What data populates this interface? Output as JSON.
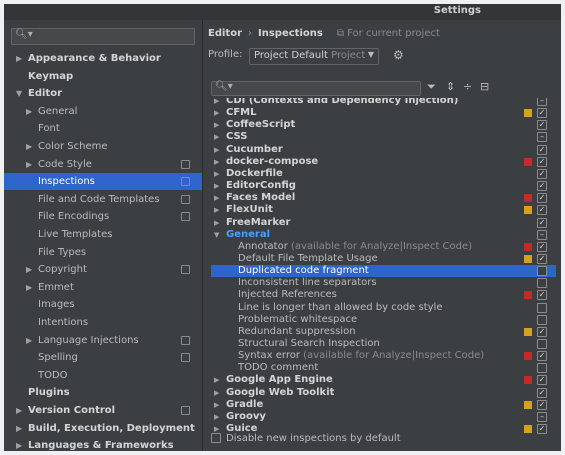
{
  "window": {
    "title": "Settings"
  },
  "sidebar": {
    "search_placeholder": "",
    "items": [
      {
        "label": "Appearance & Behavior",
        "bold": true,
        "level": 0,
        "arrow": "right",
        "badge": false,
        "selected": false
      },
      {
        "label": "Keymap",
        "bold": true,
        "level": 0,
        "arrow": "",
        "badge": false,
        "selected": false
      },
      {
        "label": "Editor",
        "bold": true,
        "level": 0,
        "arrow": "down",
        "badge": false,
        "selected": false
      },
      {
        "label": "General",
        "bold": false,
        "level": 1,
        "arrow": "right",
        "badge": false,
        "selected": false
      },
      {
        "label": "Font",
        "bold": false,
        "level": 1,
        "arrow": "",
        "badge": false,
        "selected": false
      },
      {
        "label": "Color Scheme",
        "bold": false,
        "level": 1,
        "arrow": "right",
        "badge": false,
        "selected": false
      },
      {
        "label": "Code Style",
        "bold": false,
        "level": 1,
        "arrow": "right",
        "badge": true,
        "selected": false
      },
      {
        "label": "Inspections",
        "bold": false,
        "level": 1,
        "arrow": "",
        "badge": true,
        "selected": true
      },
      {
        "label": "File and Code Templates",
        "bold": false,
        "level": 1,
        "arrow": "",
        "badge": true,
        "selected": false
      },
      {
        "label": "File Encodings",
        "bold": false,
        "level": 1,
        "arrow": "",
        "badge": true,
        "selected": false
      },
      {
        "label": "Live Templates",
        "bold": false,
        "level": 1,
        "arrow": "",
        "badge": false,
        "selected": false
      },
      {
        "label": "File Types",
        "bold": false,
        "level": 1,
        "arrow": "",
        "badge": false,
        "selected": false
      },
      {
        "label": "Copyright",
        "bold": false,
        "level": 1,
        "arrow": "right",
        "badge": true,
        "selected": false
      },
      {
        "label": "Emmet",
        "bold": false,
        "level": 1,
        "arrow": "right",
        "badge": false,
        "selected": false
      },
      {
        "label": "Images",
        "bold": false,
        "level": 1,
        "arrow": "",
        "badge": false,
        "selected": false
      },
      {
        "label": "Intentions",
        "bold": false,
        "level": 1,
        "arrow": "",
        "badge": false,
        "selected": false
      },
      {
        "label": "Language Injections",
        "bold": false,
        "level": 1,
        "arrow": "right",
        "badge": true,
        "selected": false
      },
      {
        "label": "Spelling",
        "bold": false,
        "level": 1,
        "arrow": "",
        "badge": true,
        "selected": false
      },
      {
        "label": "TODO",
        "bold": false,
        "level": 1,
        "arrow": "",
        "badge": false,
        "selected": false
      },
      {
        "label": "Plugins",
        "bold": true,
        "level": 0,
        "arrow": "",
        "badge": false,
        "selected": false
      },
      {
        "label": "Version Control",
        "bold": true,
        "level": 0,
        "arrow": "right",
        "badge": true,
        "selected": false
      },
      {
        "label": "Build, Execution, Deployment",
        "bold": true,
        "level": 0,
        "arrow": "right",
        "badge": false,
        "selected": false
      },
      {
        "label": "Languages & Frameworks",
        "bold": true,
        "level": 0,
        "arrow": "right",
        "badge": false,
        "selected": false
      }
    ]
  },
  "header": {
    "crumb_root": "Editor",
    "crumb_sep": "›",
    "crumb_leaf": "Inspections",
    "scope_note": "For current project",
    "profile_label": "Profile:",
    "profile_value": "Project Default",
    "profile_kind": "Project"
  },
  "colors": {
    "error": "#c72929",
    "warning": "#d6a11e",
    "selection": "#2f65ca"
  },
  "inspections": [
    {
      "label": "CDI (Contexts and Dependency Injection)",
      "group": true,
      "expanded": false,
      "sev": "",
      "check": "mixed"
    },
    {
      "label": "CFML",
      "group": true,
      "expanded": false,
      "sev": "warning",
      "check": "checked"
    },
    {
      "label": "CoffeeScript",
      "group": true,
      "expanded": false,
      "sev": "",
      "check": "checked"
    },
    {
      "label": "CSS",
      "group": true,
      "expanded": false,
      "sev": "",
      "check": "mixed"
    },
    {
      "label": "Cucumber",
      "group": true,
      "expanded": false,
      "sev": "",
      "check": "checked"
    },
    {
      "label": "docker-compose",
      "group": true,
      "expanded": false,
      "sev": "error",
      "check": "checked"
    },
    {
      "label": "Dockerfile",
      "group": true,
      "expanded": false,
      "sev": "",
      "check": "checked"
    },
    {
      "label": "EditorConfig",
      "group": true,
      "expanded": false,
      "sev": "",
      "check": "checked"
    },
    {
      "label": "Faces Model",
      "group": true,
      "expanded": false,
      "sev": "error",
      "check": "checked"
    },
    {
      "label": "FlexUnit",
      "group": true,
      "expanded": false,
      "sev": "warning",
      "check": "checked"
    },
    {
      "label": "FreeMarker",
      "group": true,
      "expanded": false,
      "sev": "",
      "check": "checked"
    },
    {
      "label": "General",
      "group": true,
      "expanded": true,
      "sev": "",
      "check": "mixed",
      "accent": true
    },
    {
      "label": "Annotator",
      "note": "(available for Analyze|Inspect Code)",
      "group": false,
      "sev": "error",
      "check": "checked"
    },
    {
      "label": "Default File Template Usage",
      "group": false,
      "sev": "warning",
      "check": "checked"
    },
    {
      "label": "Duplicated code fragment",
      "group": false,
      "sev": "",
      "check": "unchecked",
      "selected": true
    },
    {
      "label": "Inconsistent line separators",
      "group": false,
      "sev": "",
      "check": "unchecked"
    },
    {
      "label": "Injected References",
      "group": false,
      "sev": "error",
      "check": "checked"
    },
    {
      "label": "Line is longer than allowed by code style",
      "group": false,
      "sev": "",
      "check": "unchecked"
    },
    {
      "label": "Problematic whitespace",
      "group": false,
      "sev": "",
      "check": "unchecked"
    },
    {
      "label": "Redundant suppression",
      "group": false,
      "sev": "warning",
      "check": "checked"
    },
    {
      "label": "Structural Search Inspection",
      "group": false,
      "sev": "",
      "check": "unchecked"
    },
    {
      "label": "Syntax error",
      "note": "(available for Analyze|Inspect Code)",
      "group": false,
      "sev": "error",
      "check": "checked"
    },
    {
      "label": "TODO comment",
      "group": false,
      "sev": "",
      "check": "unchecked"
    },
    {
      "label": "Google App Engine",
      "group": true,
      "expanded": false,
      "sev": "error",
      "check": "checked"
    },
    {
      "label": "Google Web Toolkit",
      "group": true,
      "expanded": false,
      "sev": "",
      "check": "checked"
    },
    {
      "label": "Gradle",
      "group": true,
      "expanded": false,
      "sev": "warning",
      "check": "checked"
    },
    {
      "label": "Groovy",
      "group": true,
      "expanded": false,
      "sev": "",
      "check": "mixed"
    },
    {
      "label": "Guice",
      "group": true,
      "expanded": false,
      "sev": "warning",
      "check": "checked"
    }
  ],
  "footer": {
    "disable_new_label": "Disable new inspections by default"
  }
}
